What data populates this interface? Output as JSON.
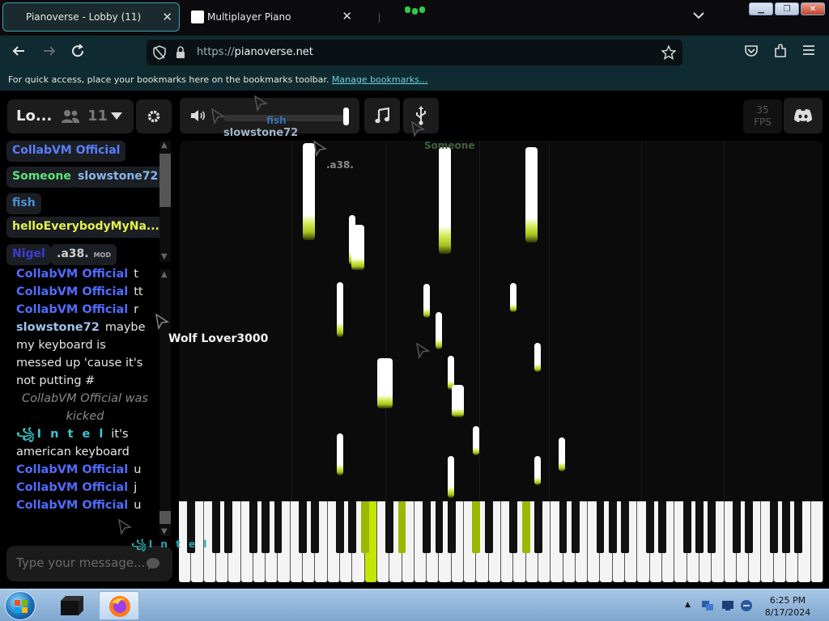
{
  "browser": {
    "tabs": [
      {
        "title": "Pianoverse - Lobby (11)",
        "active": true
      },
      {
        "title": "Multiplayer Piano",
        "active": false
      }
    ],
    "url_scheme": "https://",
    "url_host": "pianoverse.net",
    "bookmarks_message": "For quick access, place your bookmarks here on the bookmarks toolbar.",
    "bookmarks_link": "Manage bookmarks..."
  },
  "room": {
    "name": "Lo...",
    "user_count": "11"
  },
  "users": [
    {
      "name": "CollabVM Official",
      "color": "#5b7cff"
    },
    {
      "name": "Someone",
      "color": "#5fe27a"
    },
    {
      "name": "slowstone72",
      "color": "#8ab6e8"
    },
    {
      "name": "fish",
      "color": "#4e8fd6"
    },
    {
      "name": "helloEverybodyMyNa...",
      "color": "#e5f04e"
    },
    {
      "name": "Nigel",
      "color": "#3d3bd6"
    },
    {
      "name": ".a38.",
      "color": "#cfcfcf",
      "badge": "MOD"
    }
  ],
  "chat": [
    {
      "user": "CollabVM Official",
      "color": "#4e6cff",
      "text": "t"
    },
    {
      "user": "CollabVM Official",
      "color": "#4e6cff",
      "text": "tt"
    },
    {
      "user": "CollabVM Official",
      "color": "#4e6cff",
      "text": "r"
    },
    {
      "user": "slowstone72",
      "color": "#9fc2ec",
      "text": "maybe my keyboard is messed up 'cause it's not putting #"
    },
    {
      "system": "CollabVM Official was kicked"
    },
    {
      "user": "꧁I n t e l",
      "color": "#36c9cf",
      "text": "it's american keyboard"
    },
    {
      "user": "CollabVM Official",
      "color": "#4e6cff",
      "text": "u"
    },
    {
      "user": "CollabVM Official",
      "color": "#4e6cff",
      "text": "j"
    },
    {
      "user": "CollabVM Official",
      "color": "#4e6cff",
      "text": "u"
    }
  ],
  "chat_input": {
    "placeholder": "Type your message..."
  },
  "fps": {
    "value": "35",
    "label": "FPS"
  },
  "cursors": [
    {
      "name": "fish",
      "color": "#3b6fb0"
    },
    {
      "name": "slowstone72",
      "color": "#9fb4c8"
    },
    {
      "name": "Someone",
      "color": "#3f5f3f"
    },
    {
      "name": ".a38.",
      "color": "#888888"
    },
    {
      "name": "Wolf Lover3000",
      "color": "#f2f2f2"
    },
    {
      "name": "꧁I n t e l",
      "color": "#2aa8a8"
    }
  ],
  "taskbar": {
    "time": "6:25 PM",
    "date": "8/17/2024"
  },
  "colors": {
    "accent": "#3aa3b0",
    "note_glow": "#c4e600"
  }
}
